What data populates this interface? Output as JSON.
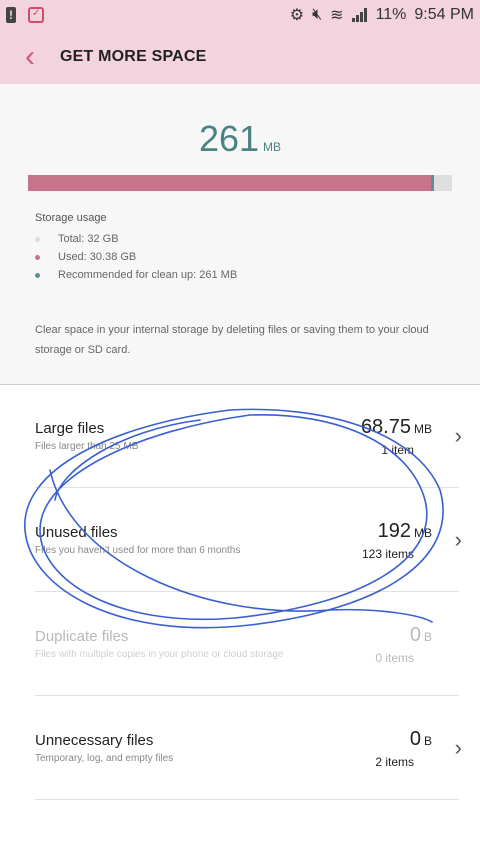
{
  "statusbar": {
    "battery": "11%",
    "time": "9:54 PM"
  },
  "appbar": {
    "title": "GET MORE SPACE"
  },
  "summary": {
    "size_value": "261",
    "size_unit": "MB",
    "used_fraction": 0.95,
    "clean_fraction": 0.008
  },
  "usage": {
    "title": "Storage usage",
    "total": "Total: 32 GB",
    "used": "Used: 30.38 GB",
    "recommended": "Recommended for clean up: 261 MB",
    "colors": {
      "total": "#dedede",
      "used": "#c77389",
      "clean": "#5d8f92"
    }
  },
  "description": "Clear space in your internal storage by deleting files or saving them to your cloud storage or SD card.",
  "items": [
    {
      "name": "Large files",
      "sub": "Files larger than 25 MB",
      "size": "68.75",
      "unit": "MB",
      "count": "1 item",
      "enabled": true
    },
    {
      "name": "Unused files",
      "sub": "Files you haven't used for more than 6 months",
      "size": "192",
      "unit": "MB",
      "count": "123 items",
      "enabled": true
    },
    {
      "name": "Duplicate files",
      "sub": "Files with multiple copies in your phone or cloud storage",
      "size": "0",
      "unit": "B",
      "count": "0 items",
      "enabled": false
    },
    {
      "name": "Unnecessary files",
      "sub": "Temporary, log, and empty files",
      "size": "0",
      "unit": "B",
      "count": "2 items",
      "enabled": true
    }
  ],
  "icons": {
    "back": "chevron-left-icon",
    "chevron": "chevron-right-icon"
  }
}
